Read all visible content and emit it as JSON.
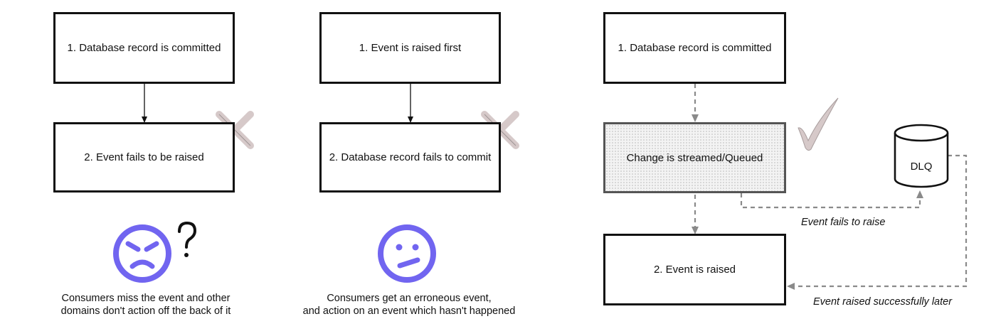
{
  "panel1": {
    "box1": "1. Database record is committed",
    "box2": "2. Event fails to be raised",
    "caption_line1": "Consumers miss the event and other",
    "caption_line2": "domains don't action off the back of it"
  },
  "panel2": {
    "box1": "1. Event is raised first",
    "box2": "2. Database record fails to commit",
    "caption_line1": "Consumers get an erroneous event,",
    "caption_line2": "and action on an event which hasn't happened"
  },
  "panel3": {
    "box1": "1. Database record is committed",
    "box_stream": "Change is streamed/Queued",
    "box3": "2. Event is raised",
    "dlq_label": "DLQ",
    "note_fail": "Event fails to raise",
    "note_retry": "Event raised successfully later"
  },
  "icons": {
    "failure": "x-mark-icon",
    "success": "check-mark-icon",
    "angry": "angry-face-icon",
    "confused": "confused-face-icon",
    "question": "question-mark-icon"
  },
  "colors": {
    "face": "#7165f0",
    "mark": "#d6c9c9",
    "arrow": "#111111",
    "dashed": "#8a8a8a"
  }
}
